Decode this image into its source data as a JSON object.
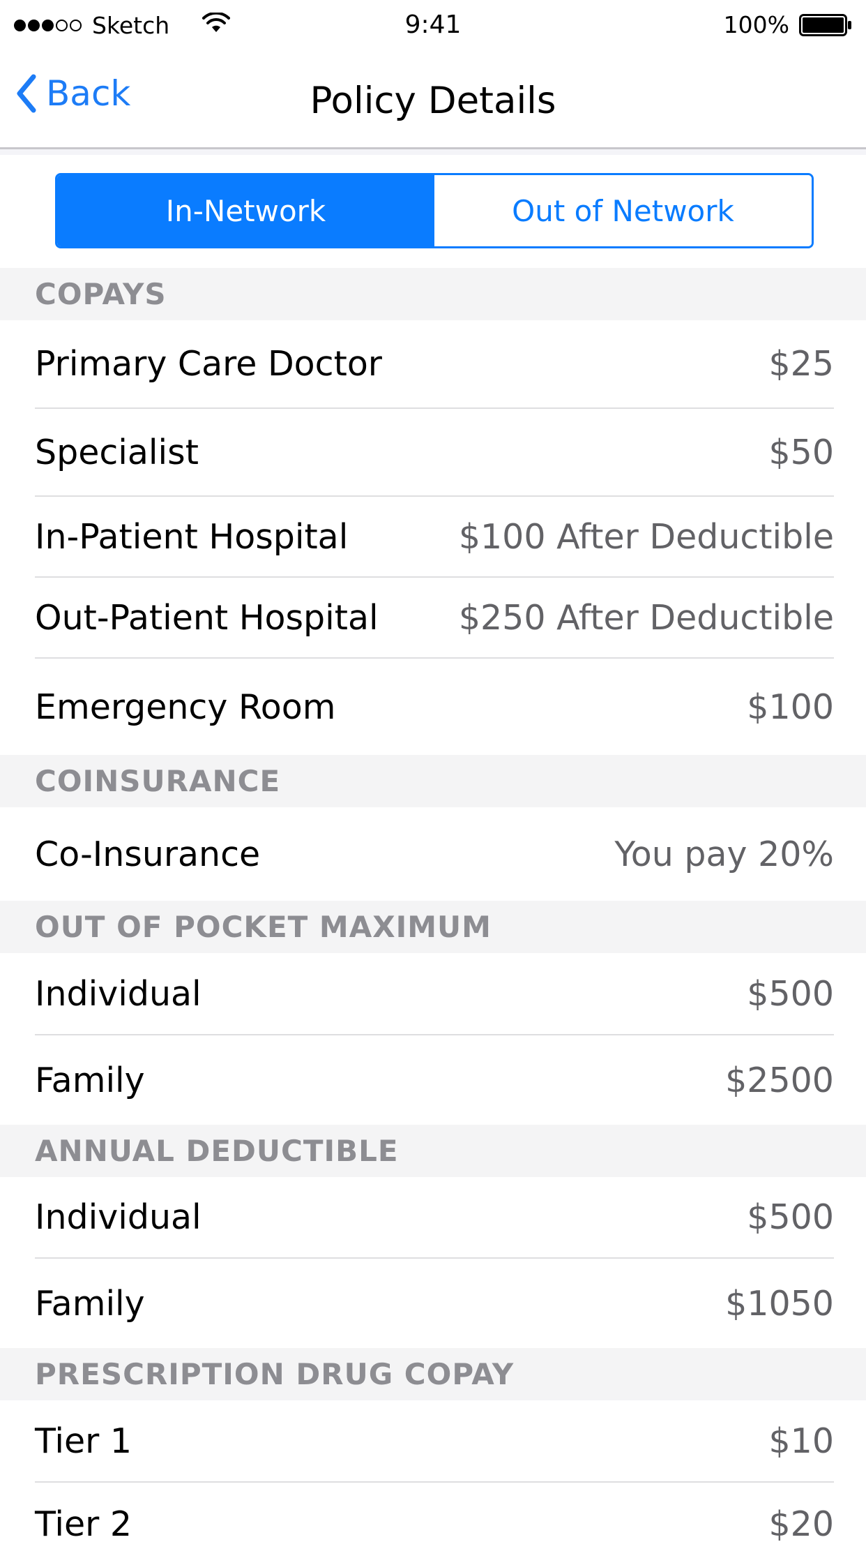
{
  "status_bar": {
    "carrier": "Sketch",
    "time": "9:41",
    "battery": "100%"
  },
  "nav": {
    "back_label": "Back",
    "title": "Policy Details"
  },
  "segments": {
    "in_network": "In-Network",
    "out_network": "Out of Network"
  },
  "sections": {
    "copays": {
      "header": "COPAYS",
      "rows": [
        {
          "label": "Primary Care Doctor",
          "value": "$25"
        },
        {
          "label": "Specialist",
          "value": "$50"
        },
        {
          "label": "In-Patient Hospital",
          "value": "$100 After Deductible"
        },
        {
          "label": "Out-Patient Hospital",
          "value": "$250 After Deductible"
        },
        {
          "label": "Emergency Room",
          "value": "$100"
        }
      ]
    },
    "coinsurance": {
      "header": "COINSURANCE",
      "rows": [
        {
          "label": "Co-Insurance",
          "value": "You pay 20%"
        }
      ]
    },
    "oop_max": {
      "header": "OUT OF POCKET MAXIMUM",
      "rows": [
        {
          "label": "Individual",
          "value": "$500"
        },
        {
          "label": "Family",
          "value": "$2500"
        }
      ]
    },
    "deductible": {
      "header": "ANNUAL DEDUCTIBLE",
      "rows": [
        {
          "label": "Individual",
          "value": "$500"
        },
        {
          "label": "Family",
          "value": "$1050"
        }
      ]
    },
    "rx": {
      "header": "PRESCRIPTION DRUG COPAY",
      "rows": [
        {
          "label": "Tier 1",
          "value": "$10"
        },
        {
          "label": "Tier 2",
          "value": "$20"
        }
      ]
    }
  },
  "colors": {
    "accent": "#0a7cff",
    "section_bg": "#f4f4f5",
    "section_text": "#8d8d92",
    "value_text": "#626266"
  }
}
